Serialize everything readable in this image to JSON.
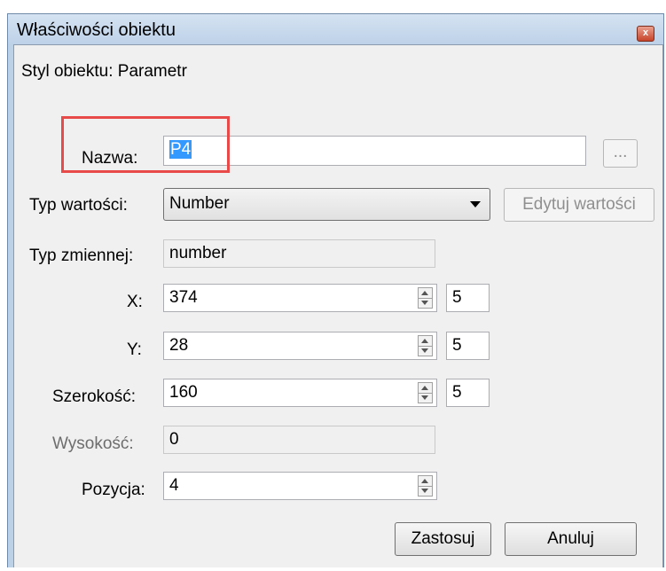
{
  "window": {
    "title": "Właściwości obiektu",
    "close_label": "x"
  },
  "style_label": "Styl obiektu: Parametr",
  "name": {
    "label": "Nazwa:",
    "value": "P4",
    "browse_label": "..."
  },
  "value_type": {
    "label": "Typ wartości:",
    "selected": "Number",
    "edit_values_label": "Edytuj wartości"
  },
  "var_type": {
    "label": "Typ zmiennej:",
    "value": "number"
  },
  "x": {
    "label": "X:",
    "value": "374",
    "step": "5"
  },
  "y": {
    "label": "Y:",
    "value": "28",
    "step": "5"
  },
  "width": {
    "label": "Szerokość:",
    "value": "160",
    "step": "5"
  },
  "height": {
    "label": "Wysokość:",
    "value": "0"
  },
  "position": {
    "label": "Pozycja:",
    "value": "4"
  },
  "buttons": {
    "apply": "Zastosuj",
    "cancel": "Anuluj"
  },
  "colors": {
    "highlight": "#e84a4a",
    "selection": "#3399ff",
    "titlebar": "#bcd0e6"
  }
}
